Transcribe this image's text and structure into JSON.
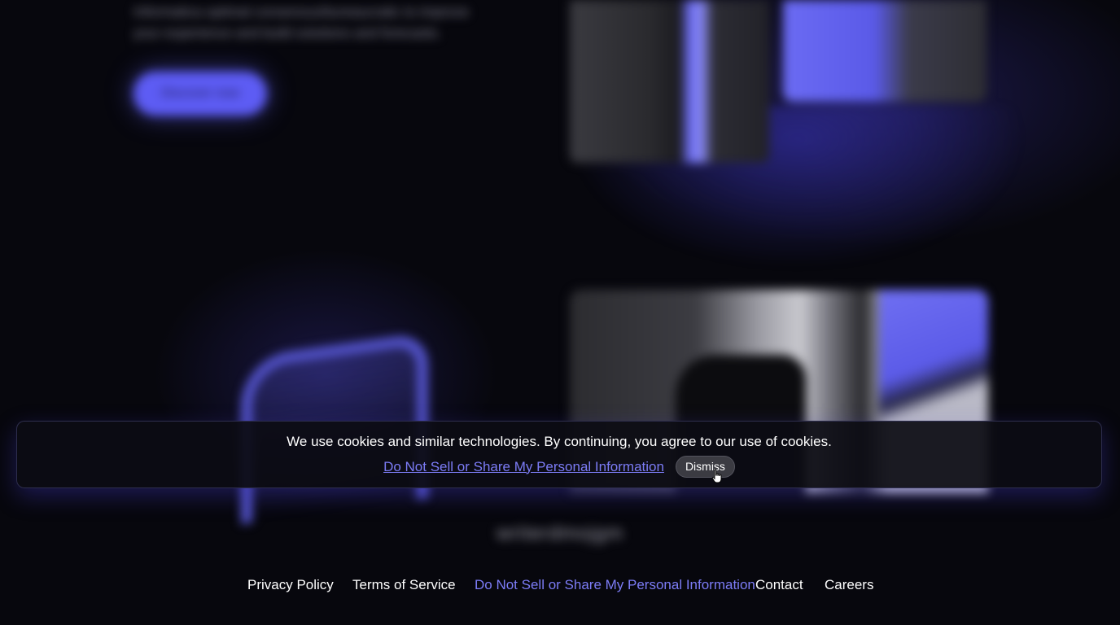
{
  "background": {
    "intro_text": "Informatica optimal consensus/bureaucratic to improve your experience and build solutions and forecasts.",
    "cta_label": "Discover now",
    "logo_text": "writerdmojgm"
  },
  "cookie_banner": {
    "message": "We use cookies and similar technologies. By continuing, you agree to our use of cookies.",
    "privacy_link": "Do Not Sell or Share My Personal Information",
    "dismiss_label": "Dismiss"
  },
  "footer": {
    "links": [
      {
        "label": "Privacy Policy"
      },
      {
        "label": "Terms of Service"
      },
      {
        "label": "Do Not Sell or Share My Personal Information"
      },
      {
        "label": "Contact"
      },
      {
        "label": "Careers"
      }
    ]
  },
  "colors": {
    "background": "#07070d",
    "accent": "#7c7cf6",
    "brand": "#5d5cf4"
  },
  "icons": {
    "cursor": "hand-pointer-icon"
  }
}
